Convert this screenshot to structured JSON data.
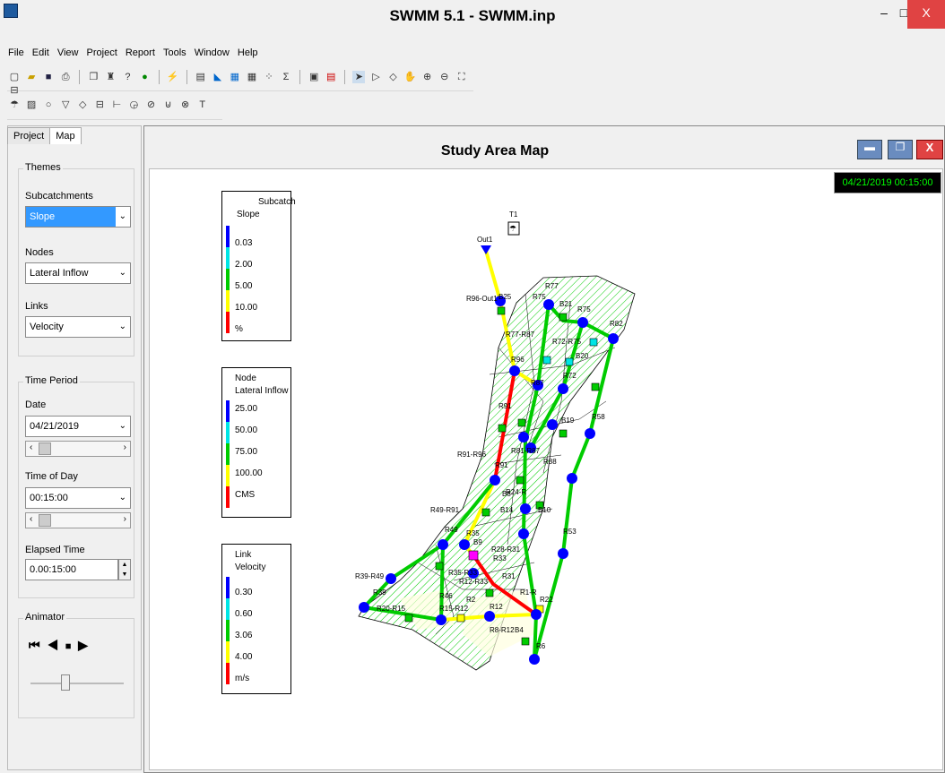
{
  "app": {
    "title": "SWMM 5.1 - SWMM.inp",
    "close_glyph": "X",
    "min_glyph": "–",
    "max_glyph": "□"
  },
  "menu": [
    "File",
    "Edit",
    "View",
    "Project",
    "Report",
    "Tools",
    "Window",
    "Help"
  ],
  "toolbar1": [
    "new-icon",
    "open-icon",
    "save-icon",
    "print-icon",
    "copy-icon",
    "find-icon",
    "query-icon",
    "overview-icon",
    "run-icon",
    "status-icon",
    "profile-icon",
    "graph-icon",
    "table-icon",
    "scatter-icon",
    "stats-icon",
    "options-icon",
    "prefs-icon",
    "select-icon",
    "vertex-icon",
    "region-icon",
    "pan-icon",
    "zoom-in-icon",
    "zoom-out-icon",
    "full-extent-icon",
    "measure-icon"
  ],
  "toolbar2": [
    "raingage-icon",
    "subcatch-icon",
    "junction-icon",
    "outfall-icon",
    "divider-icon",
    "storage-icon",
    "conduit-icon",
    "pump-icon",
    "orifice-icon",
    "weir-icon",
    "outlet-icon",
    "label-icon"
  ],
  "tabs": {
    "project": "Project",
    "map": "Map"
  },
  "themes": {
    "title": "Themes",
    "subcatch_label": "Subcatchments",
    "subcatch_value": "Slope",
    "nodes_label": "Nodes",
    "nodes_value": "Lateral Inflow",
    "links_label": "Links",
    "links_value": "Velocity"
  },
  "time": {
    "title": "Time Period",
    "date_label": "Date",
    "date_value": "04/21/2019",
    "tod_label": "Time of Day",
    "tod_value": "00:15:00",
    "elapsed_label": "Elapsed Time",
    "elapsed_value": "0.00:15:00"
  },
  "animator": {
    "title": "Animator"
  },
  "map": {
    "title": "Study Area Map",
    "clock": "04/21/2019 00:15:00"
  },
  "legends": {
    "subcatch": {
      "title1": "Subcatch",
      "title2": "Slope",
      "values": [
        "0.03",
        "2.00",
        "5.00",
        "10.00",
        "%"
      ]
    },
    "node": {
      "title1": "Node",
      "title2": "Lateral Inflow",
      "values": [
        "25.00",
        "50.00",
        "75.00",
        "100.00",
        "CMS"
      ]
    },
    "link": {
      "title1": "Link",
      "title2": "Velocity",
      "values": [
        "0.30",
        "0.60",
        "3.06",
        "4.00",
        "m/s"
      ]
    }
  },
  "colors": {
    "blue": "#0000ff",
    "cyan": "#00e5e5",
    "green": "#00cc00",
    "yellow": "#ffff00",
    "red": "#ff0000",
    "close": "#e04343"
  },
  "map_labels": {
    "t1": "T1",
    "out1": "Out1",
    "r96out1": "R96-Out1",
    "b25": "B25",
    "r77r87": "R77-R87",
    "r77": "R77",
    "r75": "R75",
    "r82": "R82",
    "b21": "B21",
    "r72r75": "R72-R75",
    "b20": "B20",
    "r96": "R96",
    "r87": "R87",
    "r72": "R72",
    "r91": "R91",
    "r91r96": "R91-R96",
    "r81r87": "R81-R87",
    "b19": "B19",
    "r58": "R58",
    "b8": "B8",
    "r24r": "R24-R",
    "r49r91": "R49-R91",
    "b14": "B14",
    "b10": "B10",
    "r53": "R53",
    "r49": "R49",
    "r35": "R35",
    "b9": "B9",
    "r28r31": "R28-R31",
    "r33": "R33",
    "r39r49": "R39-R49",
    "r35r33": "R35-R33",
    "r31": "R31",
    "r12r33": "R12-R33",
    "r1r": "R1-R",
    "r22": "R22",
    "r39": "R39",
    "r46": "R46",
    "r20r15": "R20-R15",
    "r15r12": "R15-R12",
    "r12": "R12",
    "r8r12": "R8-R12",
    "b4": "B4",
    "r6": "R6",
    "r2": "R2",
    "r88": "R88"
  }
}
